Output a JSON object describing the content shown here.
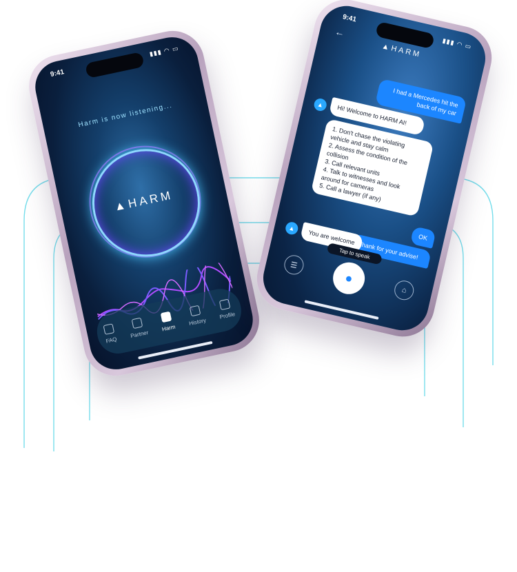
{
  "brand": {
    "name": "HARM",
    "glyph": "▲",
    "accent": "#1c86ff",
    "glow": "#49d0ff",
    "wave_color": "#b04cff"
  },
  "phone_left": {
    "time": "9:41",
    "status": "Harm is now listening...",
    "tabs": [
      {
        "label": "FAQ",
        "icon": "faq-icon"
      },
      {
        "label": "Partner",
        "icon": "partner-icon"
      },
      {
        "label": "Harm",
        "icon": "home-icon",
        "active": true
      },
      {
        "label": "History",
        "icon": "history-icon"
      },
      {
        "label": "Profile",
        "icon": "profile-icon"
      }
    ]
  },
  "phone_right": {
    "time": "9:41",
    "messages": [
      {
        "from": "user",
        "text": "I had a Mercedes hit the back of my car"
      },
      {
        "from": "bot",
        "text": "Hi! Welcome to HARM AI!"
      },
      {
        "from": "bot",
        "text": "1. Don't chase the violating vehicle and stay calm\n2. Assess the condition of the collision\n3. Call relevant units\n4. Talk to witnesses and look around for cameras\n5. Call a lawyer (if any)"
      },
      {
        "from": "user",
        "text": "OK"
      },
      {
        "from": "user",
        "text": "Thank for your advise!"
      },
      {
        "from": "bot",
        "text": "You are welcome"
      }
    ],
    "tap_to_speak": "Tap to speak"
  }
}
